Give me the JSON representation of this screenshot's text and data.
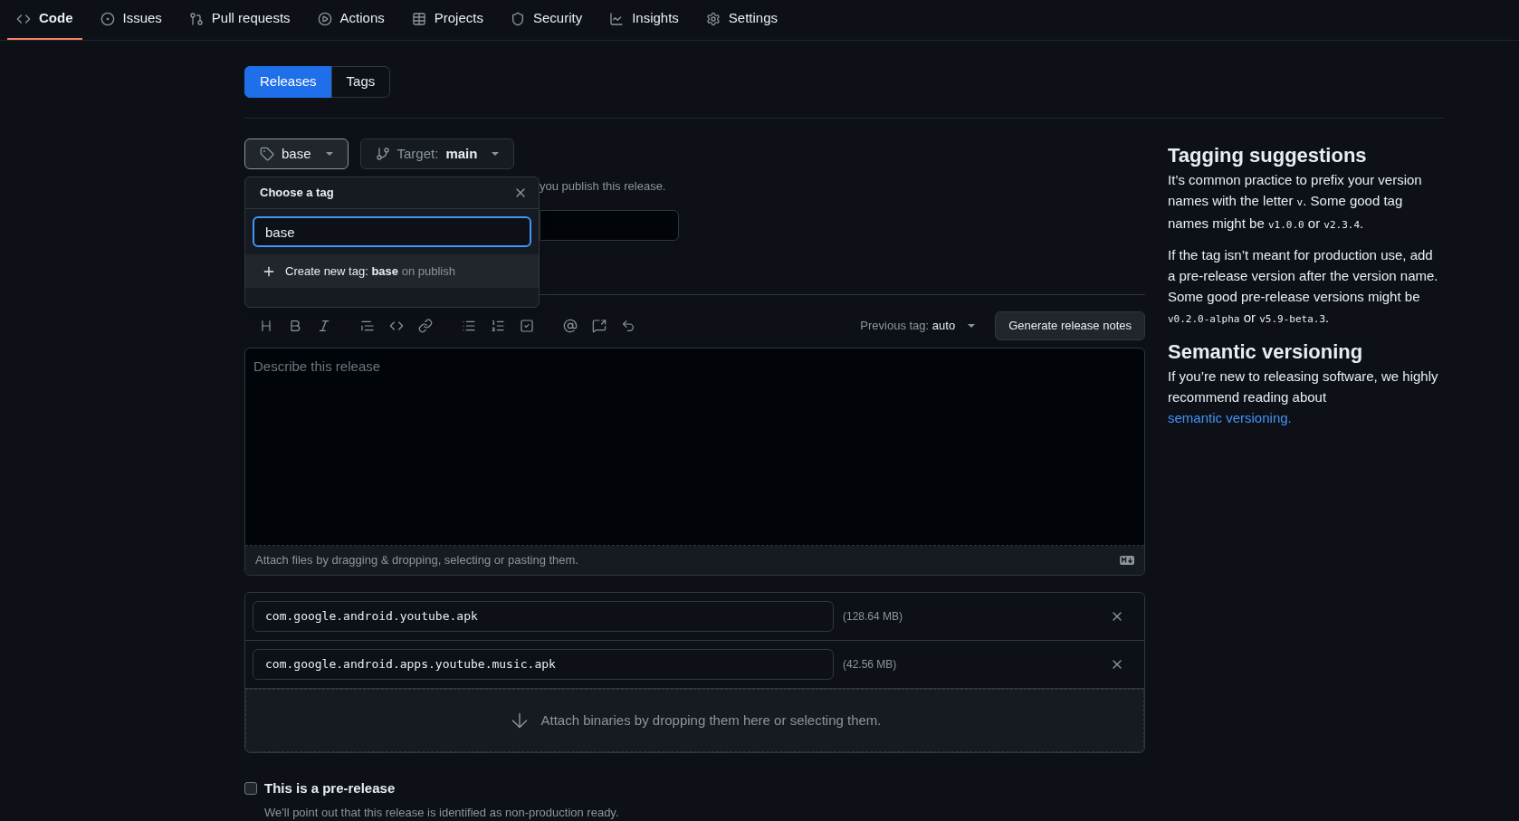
{
  "repo_nav": {
    "tabs": [
      {
        "label": "Code",
        "kind": "code",
        "selected": true
      },
      {
        "label": "Issues",
        "kind": "issues",
        "selected": false
      },
      {
        "label": "Pull requests",
        "kind": "pulls",
        "selected": false
      },
      {
        "label": "Actions",
        "kind": "actions",
        "selected": false
      },
      {
        "label": "Projects",
        "kind": "projects",
        "selected": false
      },
      {
        "label": "Security",
        "kind": "security",
        "selected": false
      },
      {
        "label": "Insights",
        "kind": "insights",
        "selected": false
      },
      {
        "label": "Settings",
        "kind": "settings",
        "selected": false
      }
    ]
  },
  "release_tabs": [
    {
      "label": "Releases",
      "selected": true
    },
    {
      "label": "Tags",
      "selected": false
    }
  ],
  "tag_button": {
    "label": "base"
  },
  "target_button": {
    "prefix": "Target:",
    "branch": "main"
  },
  "tag_hint_partial": "you publish this release.",
  "tag_menu": {
    "title": "Choose a tag",
    "search_value": "base",
    "create_option": {
      "prefix": "Create new tag:",
      "tag": "base",
      "suffix": "on publish"
    }
  },
  "editor": {
    "previous_tag": {
      "label": "Previous tag:",
      "value": "auto"
    },
    "generate_button": "Generate release notes",
    "placeholder": "Describe this release",
    "attach_hint": "Attach files by dragging & dropping, selecting or pasting them."
  },
  "assets": [
    {
      "filename": "com.google.android.youtube.apk",
      "size": "(128.64 MB)"
    },
    {
      "filename": "com.google.android.apps.youtube.music.apk",
      "size": "(42.56 MB)"
    }
  ],
  "assets_dropzone": "Attach binaries by dropping them here or selecting them.",
  "prerelease": {
    "label": "This is a pre-release",
    "checked": false,
    "description": "We'll point out that this release is identified as non-production ready."
  },
  "sidebar": {
    "sections": [
      {
        "heading": "Tagging suggestions",
        "paragraphs": [
          [
            {
              "kind": "text",
              "text": "It’s common practice to prefix your version names with the letter "
            },
            {
              "kind": "code",
              "text": "v"
            },
            {
              "kind": "text",
              "text": ". Some good tag names might be "
            },
            {
              "kind": "code",
              "text": "v1.0.0"
            },
            {
              "kind": "text",
              "text": " or "
            },
            {
              "kind": "code",
              "text": "v2.3.4"
            },
            {
              "kind": "text",
              "text": "."
            }
          ],
          [
            {
              "kind": "text",
              "text": "If the tag isn’t meant for production use, add a pre-release version after the version name. Some good pre-release versions might be "
            },
            {
              "kind": "code",
              "text": "v0.2.0-alpha"
            },
            {
              "kind": "text",
              "text": " or "
            },
            {
              "kind": "code",
              "text": "v5.9-beta.3"
            },
            {
              "kind": "text",
              "text": "."
            }
          ]
        ]
      },
      {
        "heading": "Semantic versioning",
        "paragraphs": [
          [
            {
              "kind": "text",
              "text": "If you’re new to releasing software, we highly recommend reading about "
            },
            {
              "kind": "link",
              "text": "semantic versioning."
            }
          ]
        ]
      }
    ]
  }
}
